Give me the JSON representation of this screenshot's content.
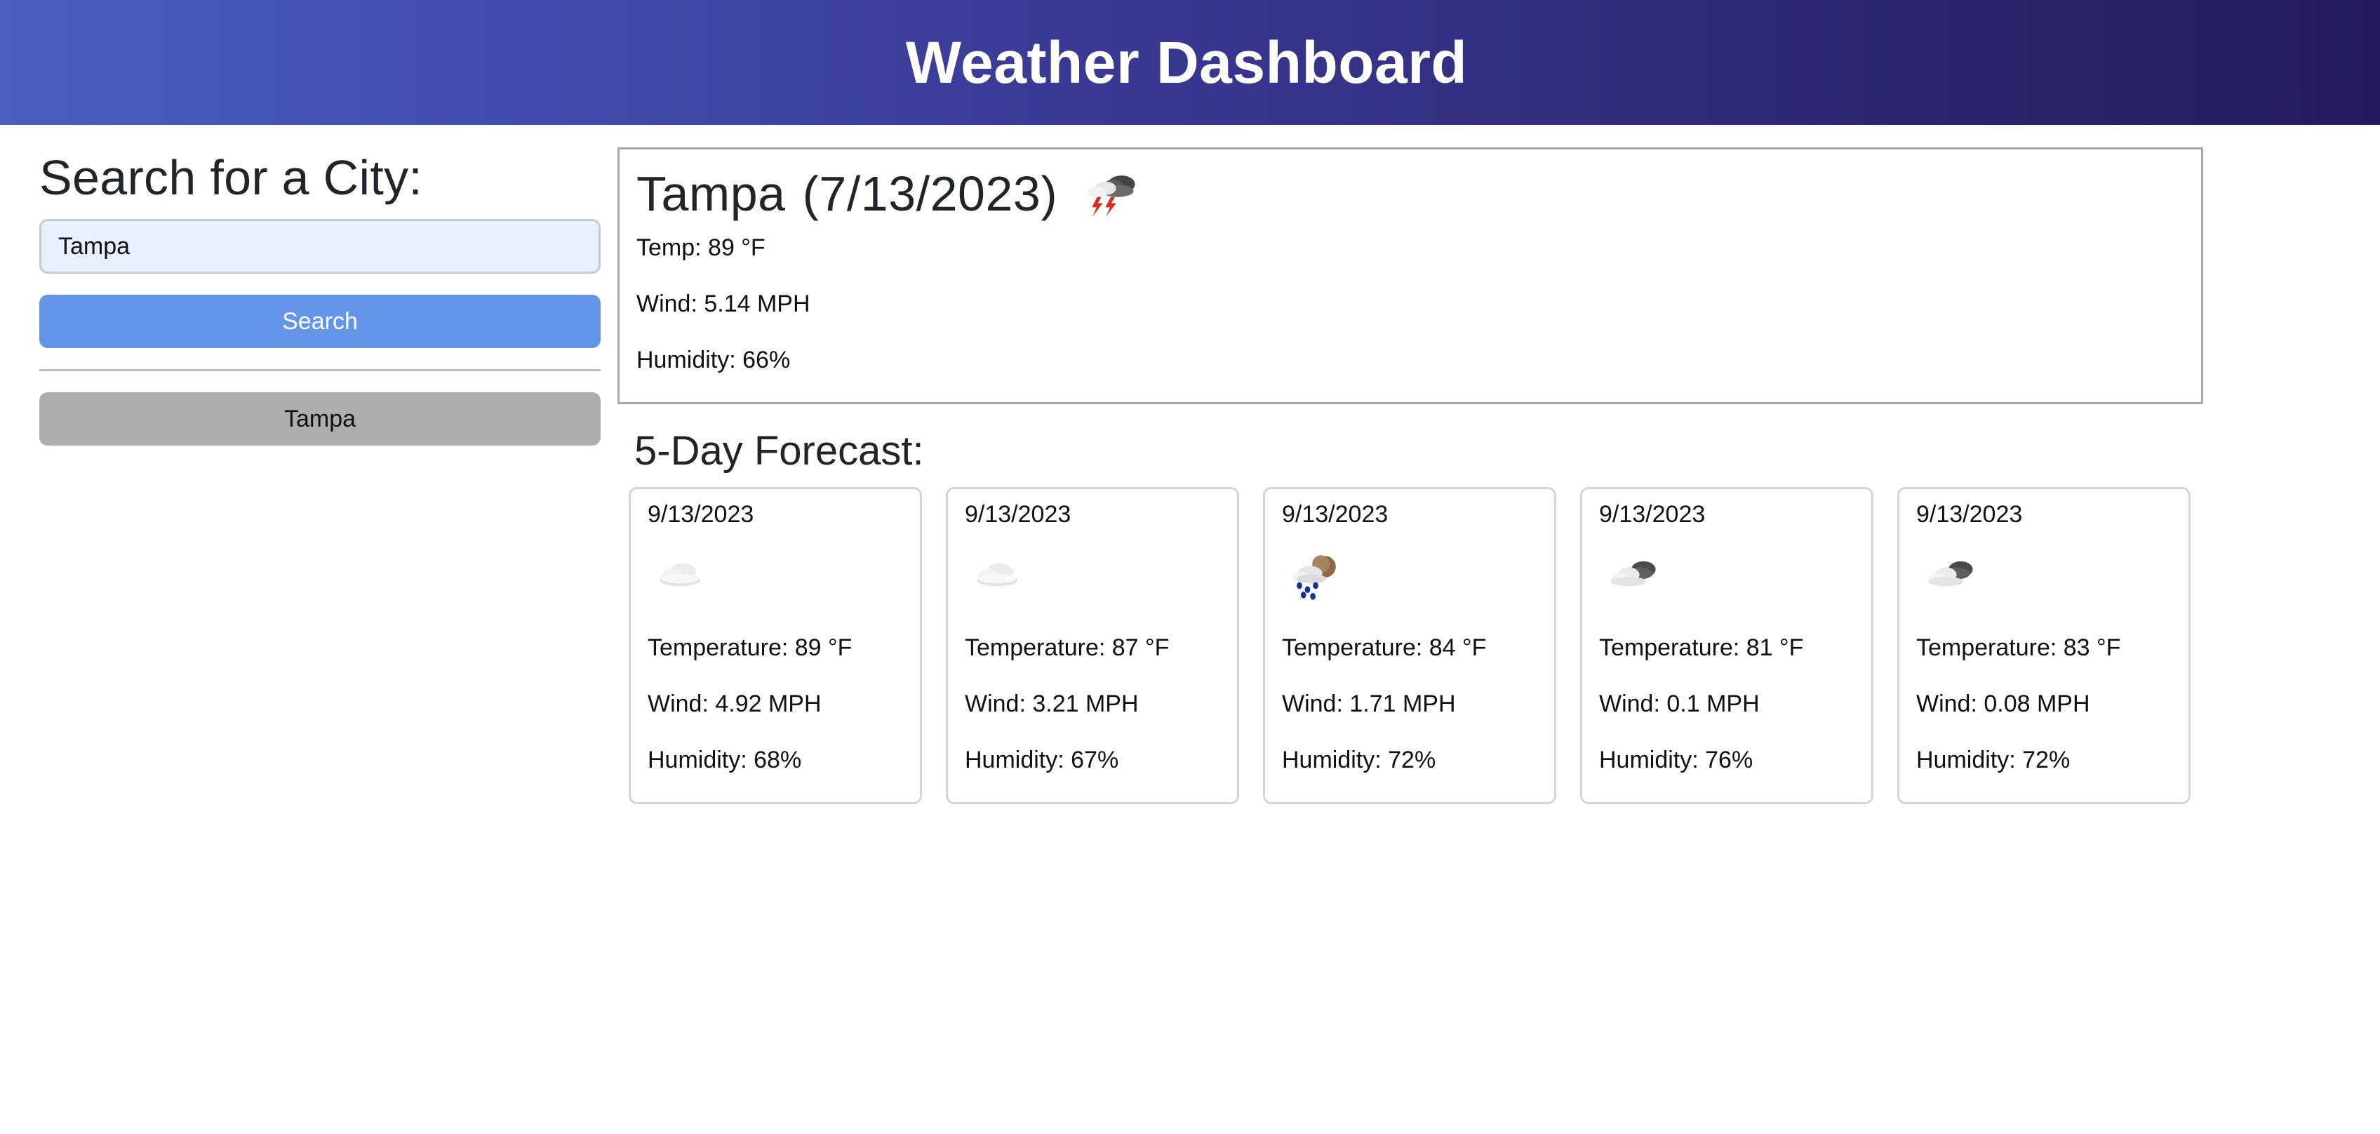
{
  "header": {
    "title": "Weather Dashboard"
  },
  "sidebar": {
    "heading": "Search for a City:",
    "search_value": "Tampa",
    "search_button": "Search",
    "history": [
      "Tampa"
    ]
  },
  "current": {
    "city": "Tampa",
    "date": "(7/13/2023)",
    "icon": "thunderstorm-icon",
    "temp": "Temp: 89 °F",
    "wind": "Wind: 5.14 MPH",
    "humidity": "Humidity: 66%"
  },
  "forecast": {
    "title": "5-Day Forecast:",
    "days": [
      {
        "date": "9/13/2023",
        "icon": "cloud-icon",
        "temp": "Temperature: 89 °F",
        "wind": "Wind: 4.92 MPH",
        "humidity": "Humidity: 68%"
      },
      {
        "date": "9/13/2023",
        "icon": "cloud-icon",
        "temp": "Temperature: 87 °F",
        "wind": "Wind: 3.21 MPH",
        "humidity": "Humidity: 67%"
      },
      {
        "date": "9/13/2023",
        "icon": "rain-moon-icon",
        "temp": "Temperature: 84 °F",
        "wind": "Wind: 1.71 MPH",
        "humidity": "Humidity: 72%"
      },
      {
        "date": "9/13/2023",
        "icon": "broken-clouds-icon",
        "temp": "Temperature: 81 °F",
        "wind": "Wind: 0.1 MPH",
        "humidity": "Humidity: 76%"
      },
      {
        "date": "9/13/2023",
        "icon": "broken-clouds-icon",
        "temp": "Temperature: 83 °F",
        "wind": "Wind: 0.08 MPH",
        "humidity": "Humidity: 72%"
      }
    ]
  }
}
